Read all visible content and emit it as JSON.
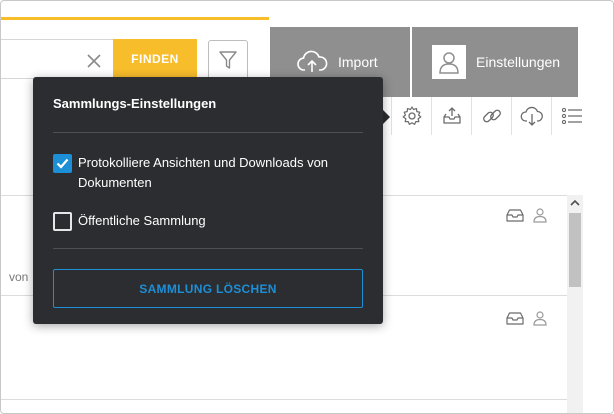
{
  "search": {
    "find_label": "FINDEN"
  },
  "tabs": {
    "import_label": "Import",
    "settings_label": "Einstellungen"
  },
  "list": {
    "von_text": "von"
  },
  "popover": {
    "title": "Sammlungs-Einstellungen",
    "log_views_label": "Protokolliere Ansichten und Downloads von Dokumenten",
    "log_views_checked": true,
    "public_label": "Öffentliche Sammlung",
    "public_checked": false,
    "delete_label": "SAMMLUNG LÖSCHEN"
  },
  "colors": {
    "accent": "#f7bd2b",
    "primary": "#1d8fd6",
    "tab_bg": "#8f8f8f",
    "popover_bg": "#2b2d30"
  },
  "icons": {
    "toolbar": [
      "gear-icon",
      "inbox-upload-icon",
      "link-icon",
      "cloud-download-icon",
      "list-icon"
    ],
    "row": [
      "inbox-icon",
      "user-icon"
    ]
  }
}
